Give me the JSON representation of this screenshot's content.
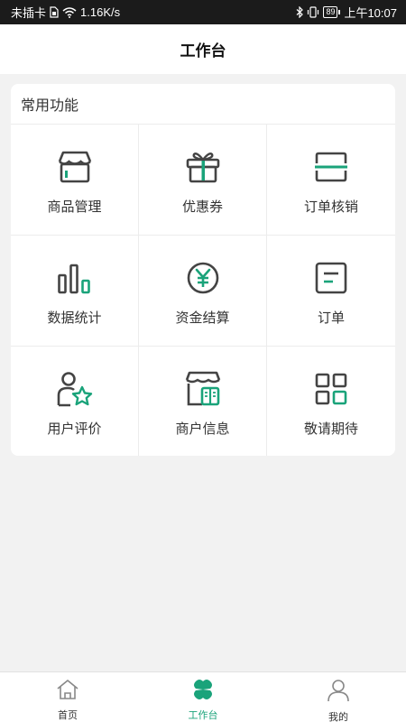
{
  "status_bar": {
    "carrier": "未插卡",
    "speed": "1.16K/s",
    "battery": "89",
    "time": "上午10:07"
  },
  "header": {
    "title": "工作台"
  },
  "section": {
    "title": "常用功能",
    "items": [
      {
        "label": "商品管理",
        "icon": "store-icon"
      },
      {
        "label": "优惠券",
        "icon": "gift-icon"
      },
      {
        "label": "订单核销",
        "icon": "scan-icon"
      },
      {
        "label": "数据统计",
        "icon": "bar-chart-icon"
      },
      {
        "label": "资金结算",
        "icon": "yen-icon"
      },
      {
        "label": "订单",
        "icon": "order-icon"
      },
      {
        "label": "用户评价",
        "icon": "user-star-icon"
      },
      {
        "label": "商户信息",
        "icon": "merchant-icon"
      },
      {
        "label": "敬请期待",
        "icon": "grid-icon"
      }
    ]
  },
  "tabbar": {
    "home": "首页",
    "workbench": "工作台",
    "mine": "我的"
  },
  "colors": {
    "accent": "#1aa37a",
    "icon_dark": "#444444"
  }
}
